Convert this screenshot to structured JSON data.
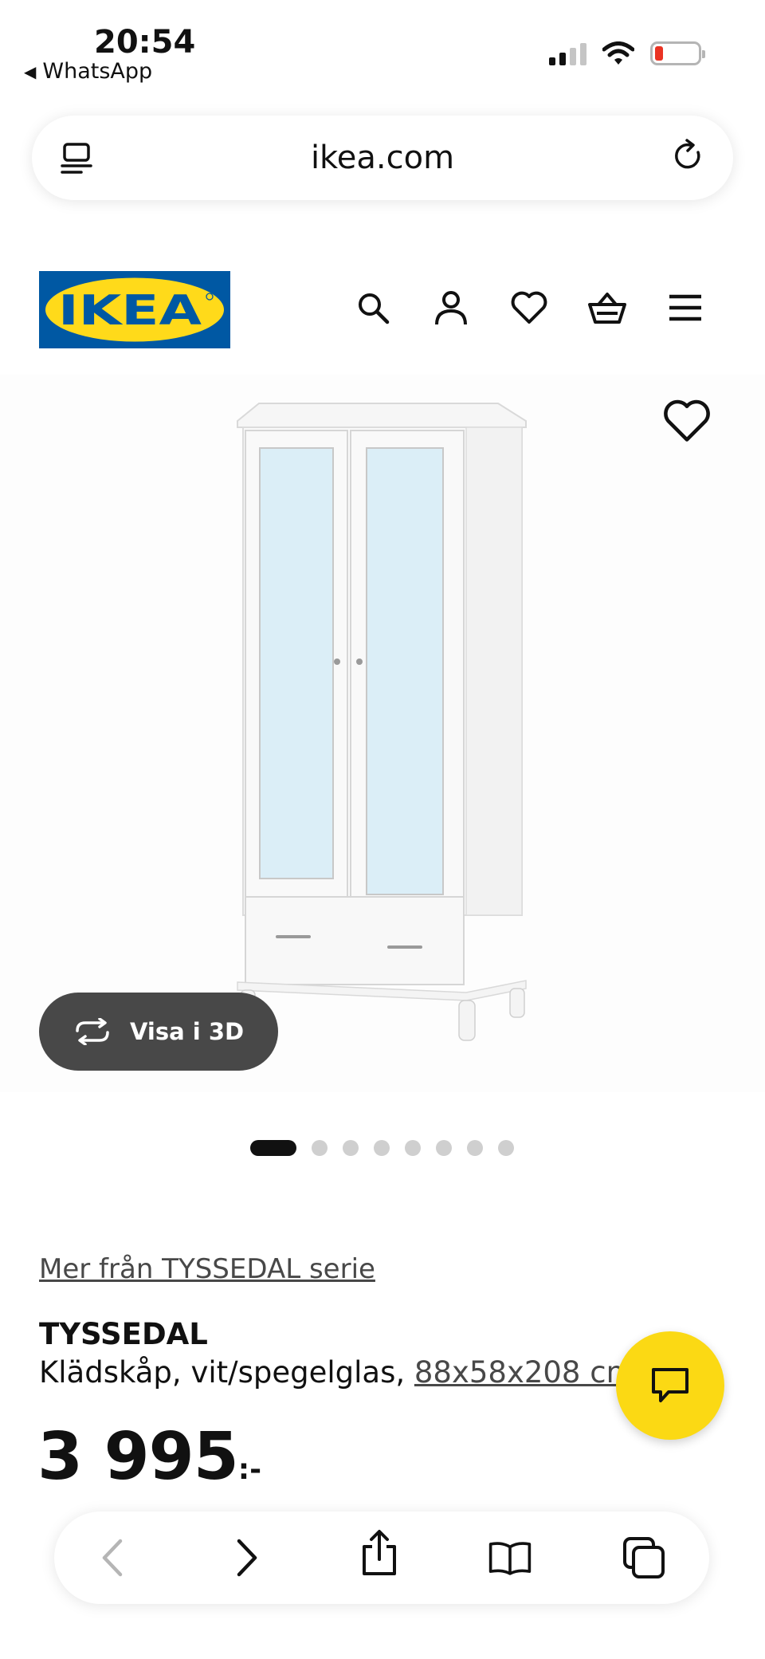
{
  "status_bar": {
    "time": "20:54",
    "back_app": "WhatsApp",
    "battery_color": "#ea3323"
  },
  "browser": {
    "url": "ikea.com",
    "reader_icon": "reader-icon",
    "reload_icon": "reload-icon"
  },
  "header": {
    "logo_text": "IKEA",
    "brand_blue": "#0058a3",
    "brand_yellow": "#ffda1a",
    "icons": [
      "search-icon",
      "account-icon",
      "favorites-icon",
      "basket-icon",
      "menu-icon"
    ]
  },
  "gallery": {
    "view_3d_label": "Visa i 3D",
    "dot_count": 8,
    "active_dot": 1
  },
  "product": {
    "series_link": "Mer från TYSSEDAL serie",
    "name": "TYSSEDAL",
    "description": "Klädskåp, vit/spegelglas, ",
    "dimensions": "88x58x208 cm",
    "price": "3 995",
    "price_suffix": ":-"
  },
  "chat": {
    "color": "#fbd914"
  },
  "toolbar": {
    "icons": [
      "back-icon",
      "forward-icon",
      "share-icon",
      "bookmarks-icon",
      "tabs-icon"
    ]
  }
}
